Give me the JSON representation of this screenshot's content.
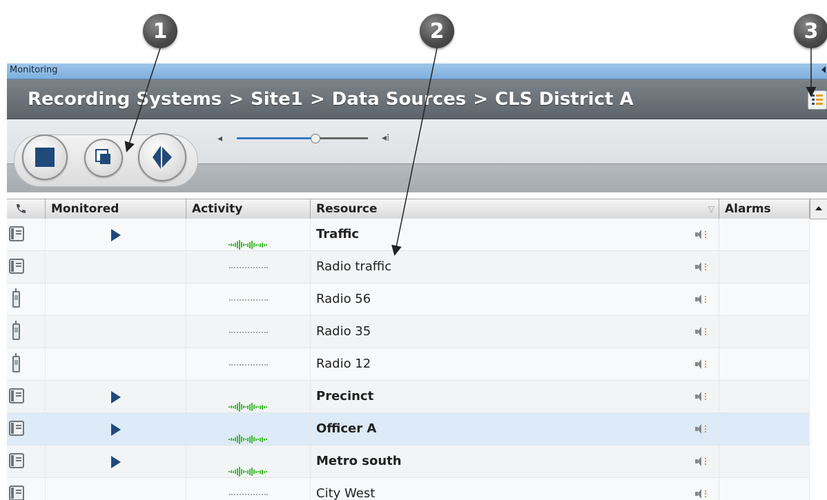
{
  "callouts": [
    "1",
    "2",
    "3"
  ],
  "panel": {
    "title": "Monitoring",
    "breadcrumb": [
      "Recording Systems",
      "Site1",
      "Data Sources",
      "CLS District A"
    ],
    "separator": ">"
  },
  "toolbar": {
    "buttons": [
      "stop-icon",
      "copy-icon",
      "barge-in-icon"
    ],
    "volume": {
      "level": 0.6,
      "low_icon": "◂",
      "high_icon": "◂⁞"
    }
  },
  "grid": {
    "columns": [
      "",
      "Monitored",
      "Activity",
      "Resource",
      "Alarms"
    ],
    "sort_indicator": "▽",
    "rows": [
      {
        "type": "phone",
        "monitored": true,
        "active": true,
        "resource": "Traffic",
        "bold": true,
        "selected": false
      },
      {
        "type": "phone",
        "monitored": false,
        "active": false,
        "resource": "Radio traffic",
        "bold": false,
        "selected": false
      },
      {
        "type": "radio",
        "monitored": false,
        "active": false,
        "resource": "Radio 56",
        "bold": false,
        "selected": false
      },
      {
        "type": "radio",
        "monitored": false,
        "active": false,
        "resource": "Radio 35",
        "bold": false,
        "selected": false
      },
      {
        "type": "radio",
        "monitored": false,
        "active": false,
        "resource": "Radio 12",
        "bold": false,
        "selected": false
      },
      {
        "type": "phone",
        "monitored": true,
        "active": true,
        "resource": "Precinct",
        "bold": true,
        "selected": false
      },
      {
        "type": "phone",
        "monitored": true,
        "active": true,
        "resource": "Officer A",
        "bold": true,
        "selected": true
      },
      {
        "type": "phone",
        "monitored": true,
        "active": true,
        "resource": "Metro south",
        "bold": true,
        "selected": false
      },
      {
        "type": "phone",
        "monitored": false,
        "active": false,
        "resource": "City West",
        "bold": false,
        "selected": false
      }
    ]
  },
  "colors": {
    "accent": "#1f4a7a",
    "activity": "#3cbf2e",
    "titlebar": "#8fbbe4",
    "header": "#666d73"
  }
}
